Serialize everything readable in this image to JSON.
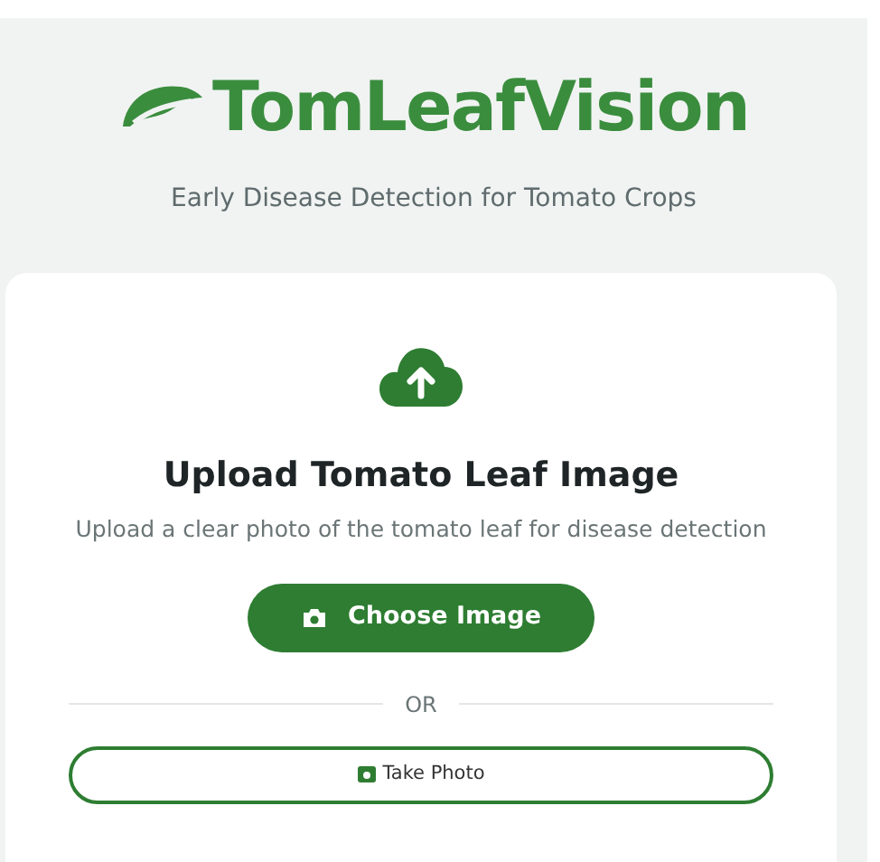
{
  "header": {
    "title": "TomLeafVision",
    "subtitle": "Early Disease Detection for Tomato Crops"
  },
  "upload_card": {
    "heading": "Upload Tomato Leaf Image",
    "description": "Upload a clear photo of the tomato leaf for disease detection",
    "primary_button": "Choose Image",
    "divider": "OR",
    "secondary_button": "Take Photo"
  }
}
